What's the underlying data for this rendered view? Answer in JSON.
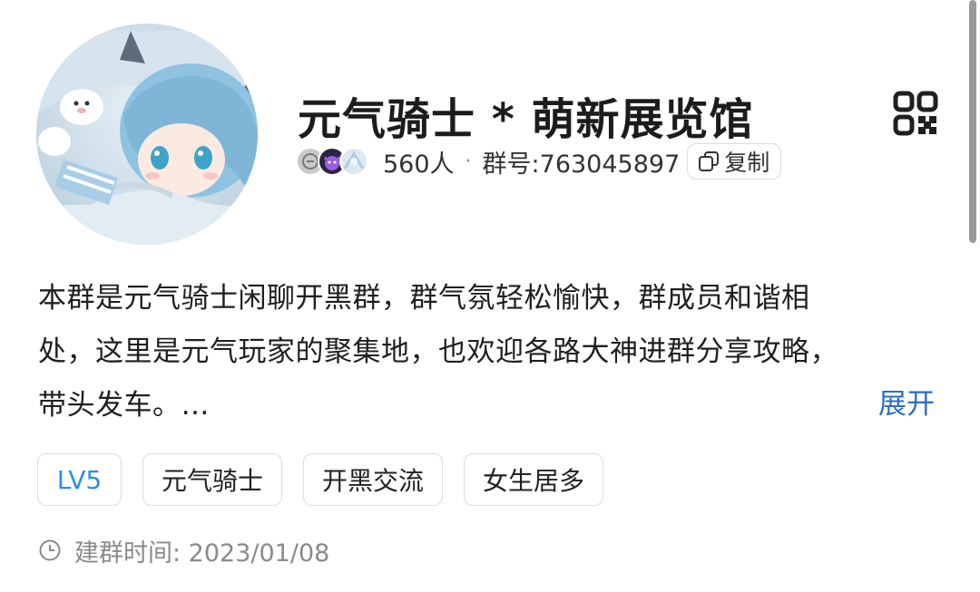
{
  "header": {
    "group_name": "元气骑士 * 萌新展览馆",
    "member_count": "560人",
    "separator": "·",
    "group_number": "群号:763045897",
    "copy_label": "复制"
  },
  "description": {
    "lines": [
      "本群是元气骑士闲聊开黑群，群气氛轻松愉快，群成员和谐相",
      "处，这里是元气玩家的聚集地，也欢迎各路大神进群分享攻略，",
      "带头发车。…"
    ],
    "expand_label": "展开"
  },
  "tags": [
    "LV5",
    "元气骑士",
    "开黑交流",
    "女生居多"
  ],
  "created": {
    "text": "建群时间: 2023/01/08"
  },
  "icons": {
    "qr": "qr-code-icon",
    "copy": "copy-icon",
    "clock": "clock-icon"
  },
  "colors": {
    "link": "#2d6cc5",
    "level_tag": "#2b8ee6",
    "muted": "#8a8a8a"
  }
}
